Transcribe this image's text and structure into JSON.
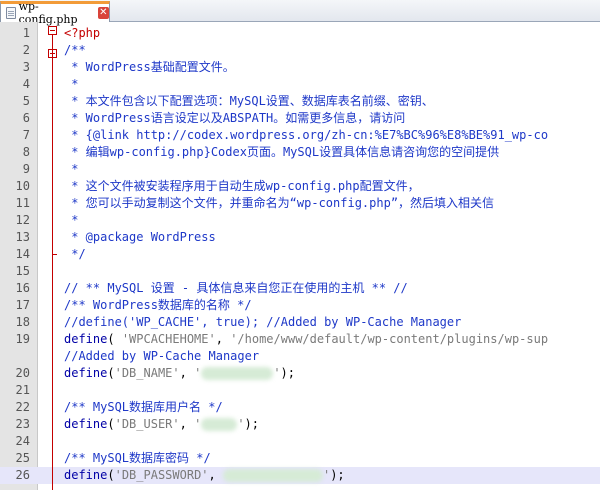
{
  "tab": {
    "title": "wp-config.php",
    "close_glyph": "✕"
  },
  "editor": {
    "current_line": 26,
    "lines": [
      {
        "n": "1",
        "segs": [
          {
            "t": "<?php",
            "c": "c-tag"
          }
        ]
      },
      {
        "n": "2",
        "segs": [
          {
            "t": "/**",
            "c": "c-cmt"
          }
        ]
      },
      {
        "n": "3",
        "segs": [
          {
            "t": " * WordPress基础配置文件。",
            "c": "c-cmt"
          }
        ]
      },
      {
        "n": "4",
        "segs": [
          {
            "t": " *",
            "c": "c-cmt"
          }
        ]
      },
      {
        "n": "5",
        "segs": [
          {
            "t": " * 本文件包含以下配置选项：MySQL设置、数据库表名前缀、密钥、",
            "c": "c-cmt"
          }
        ]
      },
      {
        "n": "6",
        "segs": [
          {
            "t": " * WordPress语言设定以及ABSPATH。如需更多信息，请访问",
            "c": "c-cmt"
          }
        ]
      },
      {
        "n": "7",
        "segs": [
          {
            "t": " * {@link http://codex.wordpress.org/zh-cn:%E7%BC%96%E8%BE%91_wp-co",
            "c": "c-cmt"
          }
        ]
      },
      {
        "n": "8",
        "segs": [
          {
            "t": " * 编辑wp-config.php}Codex页面。MySQL设置具体信息请咨询您的空间提供",
            "c": "c-cmt"
          }
        ]
      },
      {
        "n": "9",
        "segs": [
          {
            "t": " *",
            "c": "c-cmt"
          }
        ]
      },
      {
        "n": "10",
        "segs": [
          {
            "t": " * 这个文件被安装程序用于自动生成wp-config.php配置文件，",
            "c": "c-cmt"
          }
        ]
      },
      {
        "n": "11",
        "segs": [
          {
            "t": " * 您可以手动复制这个文件，并重命名为“wp-config.php”，然后填入相关信",
            "c": "c-cmt"
          }
        ]
      },
      {
        "n": "12",
        "segs": [
          {
            "t": " *",
            "c": "c-cmt"
          }
        ]
      },
      {
        "n": "13",
        "segs": [
          {
            "t": " * @package WordPress",
            "c": "c-cmt"
          }
        ]
      },
      {
        "n": "14",
        "segs": [
          {
            "t": " */",
            "c": "c-cmt"
          }
        ]
      },
      {
        "n": "15",
        "segs": []
      },
      {
        "n": "16",
        "segs": [
          {
            "t": "// ** MySQL 设置 - 具体信息来自您正在使用的主机 ** //",
            "c": "c-cmt"
          }
        ]
      },
      {
        "n": "17",
        "segs": [
          {
            "t": "/** WordPress数据库的名称 */",
            "c": "c-cmt"
          }
        ]
      },
      {
        "n": "18",
        "segs": [
          {
            "t": "//define('WP_CACHE', true); //Added by WP-Cache Manager",
            "c": "c-cmt"
          }
        ]
      },
      {
        "n": "19",
        "segs": [
          {
            "t": "define",
            "c": "c-fn"
          },
          {
            "t": "( ",
            "c": "c-plain"
          },
          {
            "t": "'WPCACHEHOME'",
            "c": "c-str"
          },
          {
            "t": ", ",
            "c": "c-plain"
          },
          {
            "t": "'/home/www/default/wp-content/plugins/wp-sup",
            "c": "c-str"
          }
        ]
      },
      {
        "n": "",
        "segs": [
          {
            "t": "//Added by WP-Cache Manager",
            "c": "c-cmt"
          }
        ]
      },
      {
        "n": "20",
        "segs": [
          {
            "t": "define",
            "c": "c-fn"
          },
          {
            "t": "(",
            "c": "c-plain"
          },
          {
            "t": "'DB_NAME'",
            "c": "c-str"
          },
          {
            "t": ", ",
            "c": "c-plain"
          },
          {
            "t": "'",
            "c": "c-str"
          },
          {
            "t": "",
            "c": "blur",
            "w": 72
          },
          {
            "t": "'",
            "c": "c-str"
          },
          {
            "t": ");",
            "c": "c-plain"
          }
        ]
      },
      {
        "n": "21",
        "segs": []
      },
      {
        "n": "22",
        "segs": [
          {
            "t": "/** MySQL数据库用户名 */",
            "c": "c-cmt"
          }
        ]
      },
      {
        "n": "23",
        "segs": [
          {
            "t": "define",
            "c": "c-fn"
          },
          {
            "t": "(",
            "c": "c-plain"
          },
          {
            "t": "'DB_USER'",
            "c": "c-str"
          },
          {
            "t": ", ",
            "c": "c-plain"
          },
          {
            "t": "'",
            "c": "c-str"
          },
          {
            "t": "",
            "c": "blur",
            "w": 36
          },
          {
            "t": "'",
            "c": "c-str"
          },
          {
            "t": ");",
            "c": "c-plain"
          }
        ]
      },
      {
        "n": "24",
        "segs": []
      },
      {
        "n": "25",
        "segs": [
          {
            "t": "/** MySQL数据库密码 */",
            "c": "c-cmt"
          }
        ]
      },
      {
        "n": "26",
        "segs": [
          {
            "t": "define",
            "c": "c-fn"
          },
          {
            "t": "(",
            "c": "c-plain"
          },
          {
            "t": "'DB_PASSWORD'",
            "c": "c-str"
          },
          {
            "t": ", ",
            "c": "c-plain"
          },
          {
            "t": "",
            "c": "blur",
            "w": 100
          },
          {
            "t": "'",
            "c": "c-str"
          },
          {
            "t": ");",
            "c": "c-plain"
          }
        ]
      }
    ]
  }
}
